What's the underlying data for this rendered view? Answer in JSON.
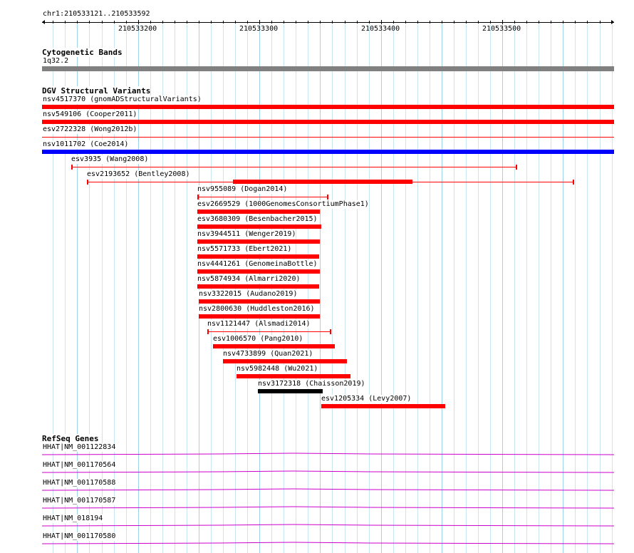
{
  "browser": {
    "locus": "chr1:210533121..210533592",
    "ruler": {
      "ticks": [
        "210533200",
        "210533300",
        "210533400",
        "210533500"
      ],
      "tick_positions": [
        210533200,
        210533300,
        210533400,
        210533500
      ]
    }
  },
  "tracks": {
    "cytoband": {
      "title": "Cytogenetic Bands",
      "band_label": "1q32.2",
      "band_color": "#808080"
    },
    "dgv": {
      "title": "DGV Structural Variants",
      "colors": {
        "loss": "#ff0000",
        "gain": "#0000ff",
        "complex": "#000000"
      },
      "features": [
        {
          "id": "nsv4517370",
          "label": "nsv4517370 (gnomADStructuralVariants)",
          "type": "thick",
          "color": "#ff0000",
          "start": 210533121,
          "end": 210533592
        },
        {
          "id": "nsv549106",
          "label": "nsv549106 (Cooper2011)",
          "type": "thick",
          "color": "#ff0000",
          "start": 210533121,
          "end": 210533592
        },
        {
          "id": "esv2722328",
          "label": "esv2722328 (Wong2012b)",
          "type": "thin",
          "color": "#ff0000",
          "start": 210533121,
          "end": 210533592
        },
        {
          "id": "nsv1011702",
          "label": "nsv1011702 (Coe2014)",
          "type": "thick",
          "color": "#0000ff",
          "start": 210533121,
          "end": 210533592
        },
        {
          "id": "esv3935",
          "label": "esv3935 (Wang2008)",
          "type": "thin",
          "color": "#ff0000",
          "start": 210533145,
          "end": 210533512
        },
        {
          "id": "esv2193652",
          "label": "esv2193652 (Bentley2008)",
          "type": "thin",
          "color": "#ff0000",
          "start": 210533158,
          "end": 210533559,
          "thick_start": 210533278,
          "thick_end": 210533426
        },
        {
          "id": "nsv955089",
          "label": "nsv955089 (Dogan2014)",
          "type": "thin",
          "color": "#ff0000",
          "start": 210533249,
          "end": 210533357
        },
        {
          "id": "esv2669529",
          "label": "esv2669529 (1000GenomesConsortiumPhase1)",
          "type": "thick",
          "color": "#ff0000",
          "start": 210533249,
          "end": 210533350
        },
        {
          "id": "esv3680309",
          "label": "esv3680309 (Besenbacher2015)",
          "type": "thick",
          "color": "#ff0000",
          "start": 210533249,
          "end": 210533351
        },
        {
          "id": "nsv3944511",
          "label": "nsv3944511 (Wenger2019)",
          "type": "thick",
          "color": "#ff0000",
          "start": 210533249,
          "end": 210533350
        },
        {
          "id": "nsv5571733",
          "label": "nsv5571733 (Ebert2021)",
          "type": "thick",
          "color": "#ff0000",
          "start": 210533249,
          "end": 210533349
        },
        {
          "id": "nsv4441261",
          "label": "nsv4441261 (GenomeinaBottle)",
          "type": "thick",
          "color": "#ff0000",
          "start": 210533249,
          "end": 210533350
        },
        {
          "id": "nsv5874934",
          "label": "nsv5874934 (Almarri2020)",
          "type": "thick",
          "color": "#ff0000",
          "start": 210533249,
          "end": 210533349
        },
        {
          "id": "nsv3322015",
          "label": "nsv3322015 (Audano2019)",
          "type": "thick",
          "color": "#ff0000",
          "start": 210533250,
          "end": 210533350
        },
        {
          "id": "nsv2800630",
          "label": "nsv2800630 (Huddleston2016)",
          "type": "thick",
          "color": "#ff0000",
          "start": 210533250,
          "end": 210533350
        },
        {
          "id": "nsv1121447",
          "label": "nsv1121447 (Alsmadi2014)",
          "type": "thin",
          "color": "#ff0000",
          "start": 210533257,
          "end": 210533359
        },
        {
          "id": "esv1006570",
          "label": "esv1006570 (Pang2010)",
          "type": "thick",
          "color": "#ff0000",
          "start": 210533262,
          "end": 210533362
        },
        {
          "id": "nsv4733899",
          "label": "nsv4733899 (Quan2021)",
          "type": "thick",
          "color": "#ff0000",
          "start": 210533270,
          "end": 210533372
        },
        {
          "id": "nsv5982448",
          "label": "nsv5982448 (Wu2021)",
          "type": "thick",
          "color": "#ff0000",
          "start": 210533281,
          "end": 210533375
        },
        {
          "id": "nsv3172318",
          "label": "nsv3172318 (Chaisson2019)",
          "type": "thick",
          "color": "#000000",
          "start": 210533299,
          "end": 210533352
        },
        {
          "id": "esv1205334",
          "label": "esv1205334 (Levy2007)",
          "type": "thick",
          "color": "#ff0000",
          "start": 210533351,
          "end": 210533453
        }
      ]
    },
    "refseq": {
      "title": "RefSeq Genes",
      "color": "#cc00cc",
      "genes": [
        {
          "label": "HHAT|NM_001122834"
        },
        {
          "label": "HHAT|NM_001170564"
        },
        {
          "label": "HHAT|NM_001170588"
        },
        {
          "label": "HHAT|NM_001170587"
        },
        {
          "label": "HHAT|NM_018194"
        },
        {
          "label": "HHAT|NM_001170580"
        }
      ]
    }
  }
}
